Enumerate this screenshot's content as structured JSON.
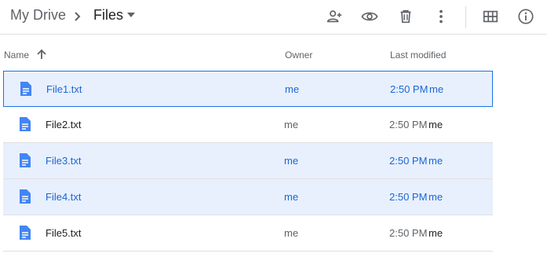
{
  "breadcrumb": {
    "root": "My Drive",
    "separator_icon": "chevron-right-icon",
    "current": "Files",
    "caret_icon": "arrow-drop-down-icon"
  },
  "toolbar": {
    "icons": [
      "share-person-add-icon",
      "preview-eye-icon",
      "trash-icon",
      "more-vert-icon",
      "grid-view-icon",
      "info-icon"
    ]
  },
  "columns": {
    "name": "Name",
    "owner": "Owner",
    "modified": "Last modified",
    "sort_icon": "arrow-upward-icon"
  },
  "colors": {
    "accent": "#1a73e8",
    "selected_bg": "#e8f0fe",
    "selected_text": "#1967d2",
    "file_icon": "#4285f4"
  },
  "files": [
    {
      "name": "File1.txt",
      "owner": "me",
      "modified": "2:50 PM",
      "modified_by": "me",
      "selected": true,
      "focused": true
    },
    {
      "name": "File2.txt",
      "owner": "me",
      "modified": "2:50 PM",
      "modified_by": "me",
      "selected": false,
      "focused": false
    },
    {
      "name": "File3.txt",
      "owner": "me",
      "modified": "2:50 PM",
      "modified_by": "me",
      "selected": true,
      "focused": false
    },
    {
      "name": "File4.txt",
      "owner": "me",
      "modified": "2:50 PM",
      "modified_by": "me",
      "selected": true,
      "focused": false
    },
    {
      "name": "File5.txt",
      "owner": "me",
      "modified": "2:50 PM",
      "modified_by": "me",
      "selected": false,
      "focused": false
    }
  ]
}
